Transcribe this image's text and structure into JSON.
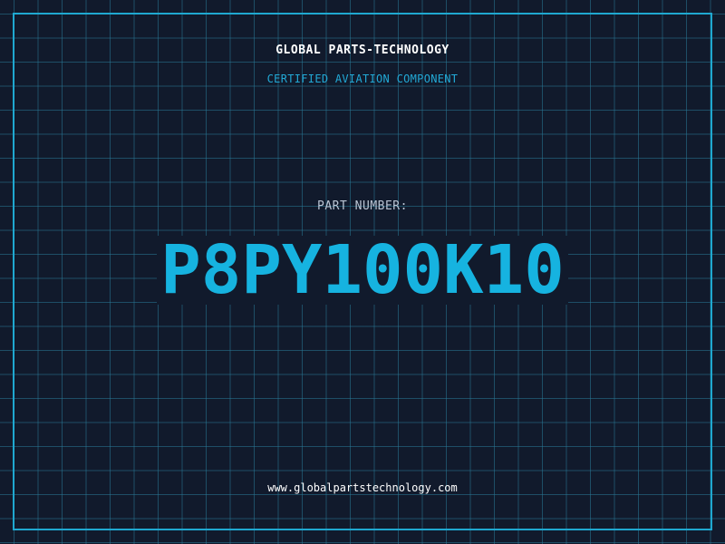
{
  "header": {
    "company_name": "GLOBAL PARTS-TECHNOLOGY",
    "subtitle": "CERTIFIED AVIATION COMPONENT"
  },
  "part": {
    "label": "PART NUMBER:",
    "number": "P8PY100K10"
  },
  "footer": {
    "website": "www.globalpartstechnology.com"
  },
  "colors": {
    "background": "#111a2c",
    "grid": "#287896",
    "frame": "#1fa8d0",
    "accent": "#16b3e0",
    "label": "#b9c4d3",
    "text": "#ffffff"
  }
}
